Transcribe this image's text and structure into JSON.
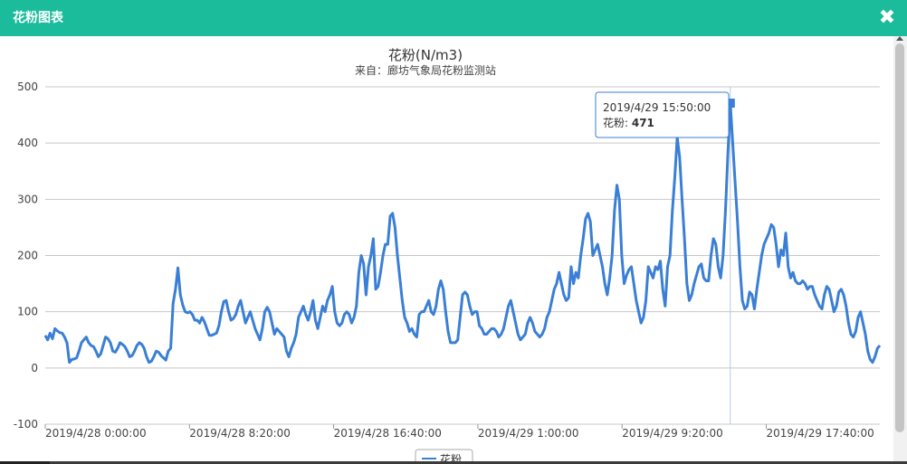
{
  "dialog": {
    "title": "花粉图表",
    "close_icon": "close-icon"
  },
  "tooltip": {
    "datetime": "2019/4/29 15:50:00",
    "label": "花粉: ",
    "value": "471"
  },
  "legend": {
    "label": "花粉"
  },
  "colors": {
    "header": "#1bbc9b",
    "series": "#3a7fd5",
    "grid": "#c8c8c8"
  },
  "chart_data": {
    "type": "line",
    "title": "花粉(N/m3)",
    "subtitle": "来自：廊坊气象局花粉监测站",
    "xlabel": "",
    "ylabel": "",
    "ylim": [
      -100,
      500
    ],
    "yticks": [
      -100,
      0,
      100,
      200,
      300,
      400,
      500
    ],
    "x_tick_labels": [
      "2019/4/28 0:00:00",
      "2019/4/28 8:20:00",
      "2019/4/28 16:40:00",
      "2019/4/29 1:00:00",
      "2019/4/29 9:20:00",
      "2019/4/29 17:40:00"
    ],
    "grid": true,
    "legend_position": "bottom-center",
    "series": [
      {
        "name": "花粉",
        "values": [
          58,
          50,
          62,
          52,
          70,
          66,
          63,
          62,
          55,
          45,
          10,
          15,
          16,
          18,
          30,
          45,
          50,
          55,
          45,
          40,
          38,
          30,
          20,
          25,
          40,
          55,
          52,
          45,
          30,
          28,
          35,
          45,
          42,
          38,
          30,
          20,
          22,
          30,
          40,
          45,
          42,
          35,
          20,
          10,
          12,
          20,
          30,
          28,
          22,
          18,
          14,
          30,
          35,
          115,
          140,
          178,
          130,
          112,
          100,
          98,
          100,
          95,
          85,
          85,
          80,
          90,
          82,
          70,
          58,
          58,
          60,
          62,
          75,
          100,
          118,
          120,
          100,
          85,
          88,
          95,
          110,
          120,
          100,
          80,
          90,
          100,
          85,
          70,
          60,
          50,
          70,
          100,
          108,
          100,
          80,
          60,
          70,
          65,
          60,
          55,
          30,
          20,
          35,
          45,
          60,
          90,
          100,
          110,
          95,
          85,
          100,
          120,
          85,
          70,
          90,
          110,
          100,
          120,
          130,
          145,
          100,
          80,
          75,
          80,
          95,
          100,
          95,
          80,
          90,
          110,
          170,
          200,
          185,
          130,
          180,
          200,
          230,
          140,
          145,
          170,
          200,
          220,
          220,
          270,
          275,
          250,
          200,
          160,
          120,
          90,
          80,
          65,
          70,
          60,
          55,
          95,
          100,
          100,
          110,
          120,
          100,
          95,
          110,
          140,
          155,
          140,
          100,
          65,
          45,
          45,
          45,
          50,
          90,
          130,
          135,
          130,
          110,
          95,
          100,
          100,
          75,
          70,
          60,
          60,
          65,
          70,
          70,
          65,
          55,
          60,
          70,
          90,
          110,
          120,
          100,
          80,
          60,
          50,
          55,
          60,
          80,
          90,
          80,
          65,
          60,
          55,
          60,
          70,
          90,
          100,
          120,
          140,
          150,
          170,
          150,
          130,
          120,
          125,
          180,
          150,
          170,
          160,
          200,
          230,
          265,
          275,
          260,
          200,
          210,
          220,
          200,
          180,
          150,
          130,
          160,
          200,
          280,
          325,
          300,
          200,
          150,
          165,
          175,
          180,
          150,
          120,
          100,
          80,
          90,
          120,
          180,
          170,
          160,
          180,
          175,
          190,
          140,
          110,
          180,
          200,
          280,
          340,
          410,
          375,
          300,
          230,
          150,
          120,
          130,
          150,
          165,
          180,
          185,
          160,
          155,
          155,
          200,
          230,
          220,
          180,
          160,
          200,
          280,
          380,
          471,
          400,
          330,
          260,
          180,
          120,
          105,
          110,
          135,
          130,
          105,
          140,
          170,
          200,
          220,
          230,
          240,
          255,
          250,
          220,
          180,
          210,
          200,
          240,
          180,
          160,
          170,
          155,
          150,
          150,
          155,
          150,
          140,
          145,
          145,
          130,
          120,
          110,
          105,
          130,
          145,
          140,
          120,
          100,
          110,
          135,
          140,
          130,
          110,
          80,
          60,
          55,
          65,
          90,
          100,
          80,
          60,
          30,
          15,
          10,
          20,
          35,
          40
        ]
      }
    ]
  }
}
